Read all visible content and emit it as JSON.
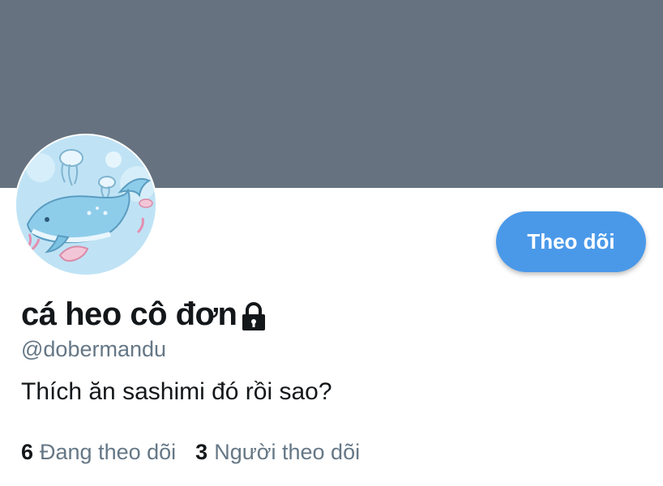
{
  "banner": {
    "color": "#66727f"
  },
  "avatar": {
    "description_icon": "whale-illustration-icon",
    "colors": [
      "#bfe3f5",
      "#8ecdea",
      "#4a99e9"
    ]
  },
  "profile": {
    "display_name": "cá heo cô đơn",
    "protected_icon": "lock-icon",
    "handle": "@dobermandu",
    "bio": "Thích ăn sashimi đó rồi sao?"
  },
  "actions": {
    "follow_label": "Theo dõi",
    "accent_color": "#4a99e9"
  },
  "stats": {
    "following_count": "6",
    "following_label": "Đang theo dõi",
    "followers_count": "3",
    "followers_label": "Người theo dõi"
  }
}
